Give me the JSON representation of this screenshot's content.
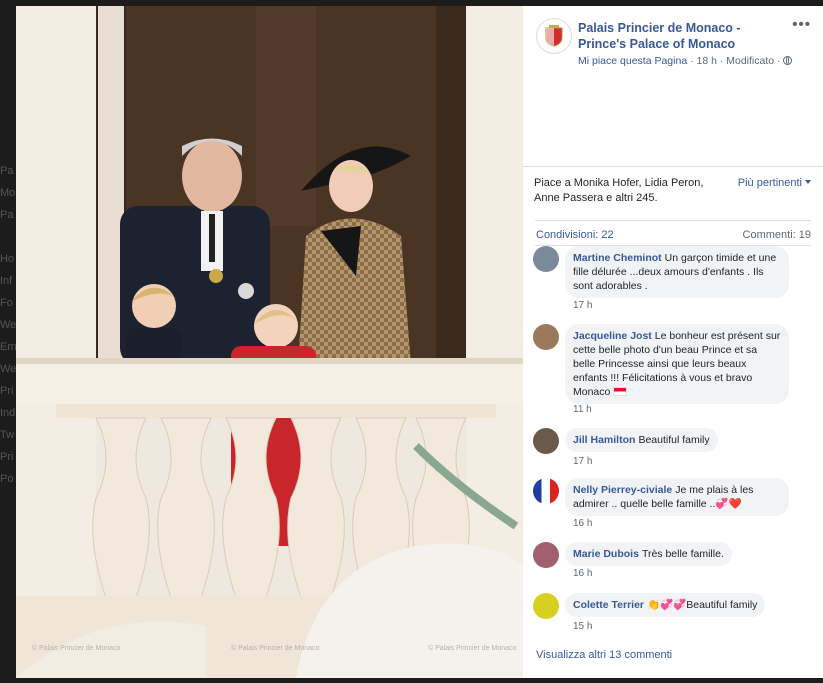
{
  "background_page": {
    "lines": [
      "Pa",
      "Mo",
      "Pa",
      "",
      "Ho",
      "Inf",
      "Fo",
      "We",
      "Em",
      "We",
      "Pri",
      "Ind",
      "Tw",
      "Pri",
      "Po"
    ]
  },
  "photo": {
    "watermark_left": "© Palais Princier de Monaco",
    "watermark_mid": "© Palais Princier de Monaco",
    "watermark_right": "© Palais Princier de Monaco"
  },
  "post": {
    "page_name": "Palais Princier de Monaco - Prince's Palace of Monaco",
    "more_label": "•••",
    "like_page": "Mi piace questa Pagina",
    "meta_rest": " · 18 h · Modificato · ",
    "likes_text": "Piace a Monika Hofer, Lidia Peron, Anne Passera e altri 245.",
    "relevant_label": "Più pertinenti",
    "shares": "Condivisioni: 22",
    "comments_count": "Commenti: 19",
    "view_more": "Visualizza altri 13 commenti"
  },
  "comments": [
    {
      "author": "Martine Cheminot",
      "text": "Un garçon timide et une fille délurée ...deux amours d'enfants . Ils sont adorables .",
      "time": "17 h",
      "avatar_color": "#7b8a9a"
    },
    {
      "author": "Jacqueline Jost",
      "text": "Le bonheur est présent sur cette belle photo d'un beau Prince et sa belle Princesse ainsi que leurs beaux enfants !!! Félicitations à vous et bravo Monaco",
      "time": "11 h",
      "avatar_color": "#9a7a5a"
    },
    {
      "author": "Jill Hamilton",
      "text": "Beautiful family",
      "time": "17 h",
      "avatar_color": "#6a5a4a"
    },
    {
      "author": "Nelly Pierrey-civiale",
      "text": "Je me plais à les admirer .. quelle belle famille ..",
      "emoji": "💞❤️",
      "time": "16 h",
      "avatar_color": "#3050a0"
    },
    {
      "author": "Marie Dubois",
      "text": "Très belle famille.",
      "time": "16 h",
      "avatar_color": "#a06070"
    },
    {
      "author": "Colette Terrier",
      "emoji_before": "👏💞💞",
      "text": "Beautiful family",
      "time": "15 h",
      "avatar_color": "#d8d020"
    }
  ],
  "colors": {
    "link": "#385898",
    "secondary": "#606770",
    "bubble": "#f2f3f5"
  }
}
